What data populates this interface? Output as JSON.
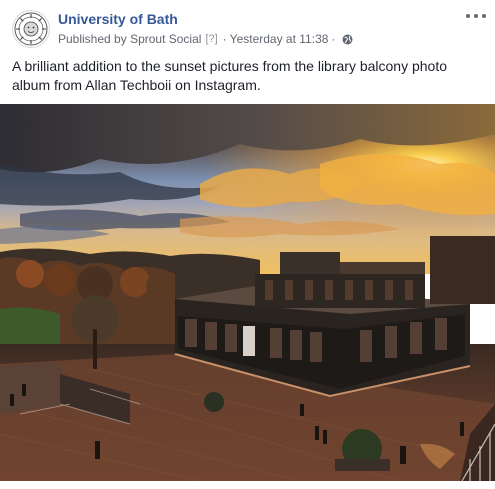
{
  "post": {
    "page_name": "University of Bath",
    "published_by_prefix": "Published by",
    "publisher": "Sprout Social",
    "help_marker": "[?]",
    "separator": "·",
    "timestamp": "Yesterday at 11:38",
    "audience_icon": "globe-icon",
    "options_icon": "more-options-icon",
    "text": "A brilliant addition to the sunset pictures from the library balcony photo album from Allan Techboii on Instagram.",
    "photo_icon": "photo"
  },
  "colors": {
    "page_name": "#365899",
    "meta": "#616770",
    "body_text": "#1d2129"
  }
}
